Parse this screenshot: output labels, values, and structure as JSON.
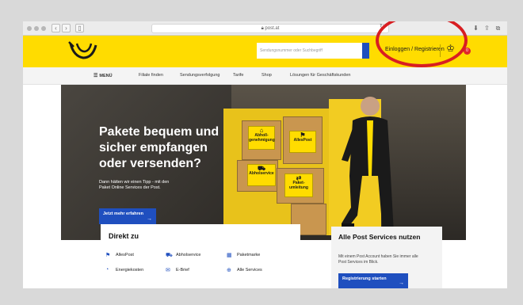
{
  "browser": {
    "url": "post.at",
    "back": "‹",
    "forward": "›"
  },
  "header": {
    "search_placeholder": "Sendungsnummer oder Suchbegriff",
    "login": "Einloggen / Registrieren",
    "cart_count": "0"
  },
  "nav": {
    "menu": "MENÜ",
    "items": [
      "Filiale finden",
      "Sendungsverfolgung",
      "Tarife",
      "Shop",
      "Lösungen für Geschäftskunden"
    ]
  },
  "hero": {
    "title_line1": "Pakete bequem und",
    "title_line2": "sicher empfangen",
    "title_line3": "oder versenden?",
    "subtitle": "Dann hätten wir einen Tipp - mit den Paket Online Services der Post.",
    "cta": "Jetzt mehr erfahren",
    "boxes": [
      "Abholl-genehmigung",
      "AllesPost",
      "Abholservice",
      "Paket-umleitung"
    ]
  },
  "direkt": {
    "title": "Direkt zu",
    "items": [
      "AllesPost",
      "Abholservice",
      "Paketmarke",
      "Energiekosten",
      "E-Brief",
      "Alle Services"
    ]
  },
  "services": {
    "title": "Alle Post Services nutzen",
    "text": "Mit einem Post Account haben Sie immer alle Post Services im Blick.",
    "cta": "Registrierung starten"
  },
  "colors": {
    "brand_yellow": "#ffdc00",
    "brand_blue": "#1f4fbf",
    "highlight_red": "#d81e22"
  }
}
